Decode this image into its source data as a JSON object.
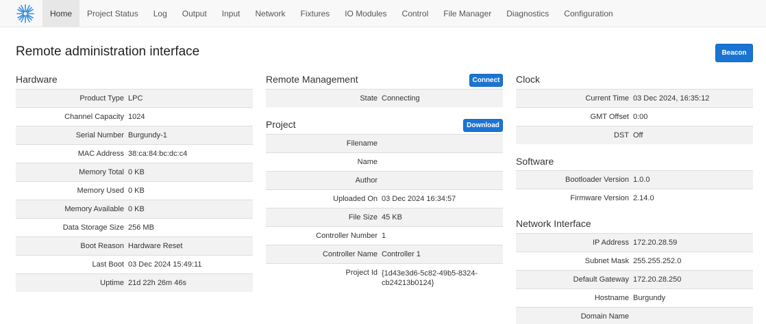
{
  "nav": {
    "items": [
      {
        "label": "Home",
        "active": true
      },
      {
        "label": "Project Status"
      },
      {
        "label": "Log"
      },
      {
        "label": "Output"
      },
      {
        "label": "Input"
      },
      {
        "label": "Network"
      },
      {
        "label": "Fixtures"
      },
      {
        "label": "IO Modules"
      },
      {
        "label": "Control"
      },
      {
        "label": "File Manager"
      },
      {
        "label": "Diagnostics"
      },
      {
        "label": "Configuration"
      }
    ],
    "logo_icon": "starburst-logo-icon"
  },
  "page": {
    "title": "Remote administration interface",
    "beacon_label": "Beacon"
  },
  "hardware": {
    "title": "Hardware",
    "rows": [
      {
        "key": "Product Type",
        "value": "LPC"
      },
      {
        "key": "Channel Capacity",
        "value": "1024"
      },
      {
        "key": "Serial Number",
        "value": "Burgundy-1"
      },
      {
        "key": "MAC Address",
        "value": "38:ca:84:bc:dc:c4"
      },
      {
        "key": "Memory Total",
        "value": "0 KB"
      },
      {
        "key": "Memory Used",
        "value": "0 KB"
      },
      {
        "key": "Memory Available",
        "value": "0 KB"
      },
      {
        "key": "Data Storage Size",
        "value": "256 MB"
      },
      {
        "key": "Boot Reason",
        "value": "Hardware Reset"
      },
      {
        "key": "Last Boot",
        "value": "03 Dec 2024 15:49:11"
      },
      {
        "key": "Uptime",
        "value": "21d 22h 26m 46s"
      }
    ]
  },
  "remote_management": {
    "title": "Remote Management",
    "connect_label": "Connect",
    "rows": [
      {
        "key": "State",
        "value": "Connecting"
      }
    ]
  },
  "project": {
    "title": "Project",
    "download_label": "Download",
    "rows": [
      {
        "key": "Filename",
        "value": ""
      },
      {
        "key": "Name",
        "value": ""
      },
      {
        "key": "Author",
        "value": ""
      },
      {
        "key": "Uploaded On",
        "value": "03 Dec 2024 16:34:57"
      },
      {
        "key": "File Size",
        "value": "45 KB"
      },
      {
        "key": "Controller Number",
        "value": "1"
      },
      {
        "key": "Controller Name",
        "value": "Controller 1"
      },
      {
        "key": "Project Id",
        "value": "{1d43e3d6-5c82-49b5-8324-cb24213b0124}"
      }
    ]
  },
  "clock": {
    "title": "Clock",
    "rows": [
      {
        "key": "Current Time",
        "value": "03 Dec 2024, 16:35:12"
      },
      {
        "key": "GMT Offset",
        "value": "0:00"
      },
      {
        "key": "DST",
        "value": "Off"
      }
    ]
  },
  "software": {
    "title": "Software",
    "rows": [
      {
        "key": "Bootloader Version",
        "value": "1.0.0"
      },
      {
        "key": "Firmware Version",
        "value": "2.14.0"
      }
    ]
  },
  "network": {
    "title": "Network Interface",
    "rows": [
      {
        "key": "IP Address",
        "value": "172.20.28.59"
      },
      {
        "key": "Subnet Mask",
        "value": "255.255.252.0"
      },
      {
        "key": "Default Gateway",
        "value": "172.20.28.250"
      },
      {
        "key": "Hostname",
        "value": "Burgundy"
      },
      {
        "key": "Domain Name",
        "value": ""
      }
    ]
  },
  "colors": {
    "accent": "#1a75d2",
    "logo": "#3a8fe0"
  }
}
